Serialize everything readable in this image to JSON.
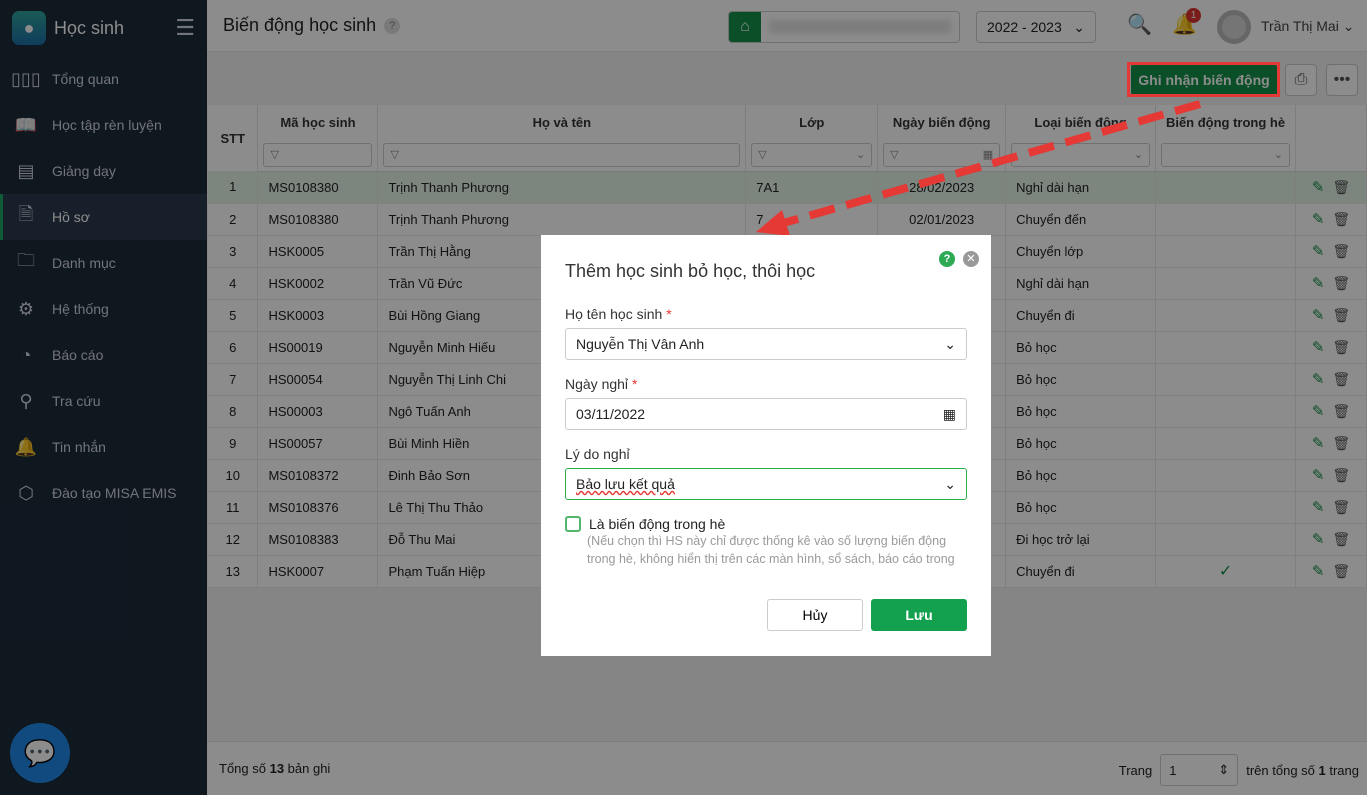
{
  "app": {
    "name": "Học sinh"
  },
  "sidebar": {
    "items": [
      {
        "label": "Tổng quan",
        "icon": "chart-bars-icon"
      },
      {
        "label": "Học tập rèn luyện",
        "icon": "book-icon"
      },
      {
        "label": "Giảng dạy",
        "icon": "board-icon"
      },
      {
        "label": "Hồ sơ",
        "icon": "document-icon",
        "active": true
      },
      {
        "label": "Danh mục",
        "icon": "folder-icon"
      },
      {
        "label": "Hệ thống",
        "icon": "gear-icon"
      },
      {
        "label": "Báo cáo",
        "icon": "pie-chart-icon"
      },
      {
        "label": "Tra cứu",
        "icon": "search-icon"
      },
      {
        "label": "Tin nhắn",
        "icon": "bell-icon"
      },
      {
        "label": "Đào tạo MISA EMIS",
        "icon": "box-icon"
      }
    ]
  },
  "header": {
    "title": "Biến động học sinh",
    "help": "?",
    "school_year": "2022 - 2023",
    "notification_count": "1",
    "user_name": "Trần Thị Mai"
  },
  "toolbar": {
    "record_button": "Ghi nhận biến động"
  },
  "table": {
    "columns": [
      "STT",
      "Mã học sinh",
      "Họ và tên",
      "Lớp",
      "Ngày biến động",
      "Loại biến động",
      "Biến động trong hè"
    ],
    "rows": [
      {
        "stt": "1",
        "code": "MS0108380",
        "name": "Trịnh Thanh Phương",
        "class": "7A1",
        "date": "28/02/2023",
        "type": "Nghỉ dài hạn",
        "summer": ""
      },
      {
        "stt": "2",
        "code": "MS0108380",
        "name": "Trịnh Thanh Phương",
        "class": "7",
        "date": "02/01/2023",
        "type": "Chuyển đến",
        "summer": ""
      },
      {
        "stt": "3",
        "code": "HSK0005",
        "name": "Trần Thị Hằng",
        "class": "",
        "date": "",
        "type": "Chuyển lớp",
        "summer": ""
      },
      {
        "stt": "4",
        "code": "HSK0002",
        "name": "Trần Vũ Đức",
        "class": "",
        "date": "",
        "type": "Nghỉ dài hạn",
        "summer": ""
      },
      {
        "stt": "5",
        "code": "HSK0003",
        "name": "Bùi Hồng Giang",
        "class": "",
        "date": "",
        "type": "Chuyển đi",
        "summer": ""
      },
      {
        "stt": "6",
        "code": "HS00019",
        "name": "Nguyễn Minh Hiếu",
        "class": "",
        "date": "",
        "type": "Bỏ học",
        "summer": ""
      },
      {
        "stt": "7",
        "code": "HS00054",
        "name": "Nguyễn Thị Linh Chi",
        "class": "",
        "date": "",
        "type": "Bỏ học",
        "summer": ""
      },
      {
        "stt": "8",
        "code": "HS00003",
        "name": "Ngô Tuấn Anh",
        "class": "",
        "date": "",
        "type": "Bỏ học",
        "summer": ""
      },
      {
        "stt": "9",
        "code": "HS00057",
        "name": "Bùi Minh Hiền",
        "class": "",
        "date": "",
        "type": "Bỏ học",
        "summer": ""
      },
      {
        "stt": "10",
        "code": "MS0108372",
        "name": "Đinh Bảo Sơn",
        "class": "",
        "date": "",
        "type": "Bỏ học",
        "summer": ""
      },
      {
        "stt": "11",
        "code": "MS0108376",
        "name": "Lê Thị Thu Thảo",
        "class": "",
        "date": "",
        "type": "Bỏ học",
        "summer": ""
      },
      {
        "stt": "12",
        "code": "MS0108383",
        "name": "Đỗ Thu Mai",
        "class": "",
        "date": "",
        "type": "Đi học trở lại",
        "summer": ""
      },
      {
        "stt": "13",
        "code": "HSK0007",
        "name": "Phạm Tuấn Hiệp",
        "class": "",
        "date": "",
        "type": "Chuyển đi",
        "summer": "✓"
      }
    ]
  },
  "footer": {
    "total_prefix": "Tổng số ",
    "total": "13",
    "total_suffix": " bản ghi",
    "page_label": "Trang",
    "page": "1",
    "pages_prefix": "trên tổng số ",
    "pages": "1",
    "pages_suffix": " trang"
  },
  "modal": {
    "title": "Thêm học sinh bỏ học, thôi học",
    "student_label": "Họ tên học sinh",
    "student_value": "Nguyễn Thị Vân Anh",
    "date_label": "Ngày nghỉ",
    "date_value": "03/11/2022",
    "reason_label": "Lý do nghỉ",
    "reason_value": "Bảo lưu kết quả",
    "summer_label": "Là biến động trong hè",
    "summer_note": "(Nếu chọn thì HS này chỉ được thống kê vào số lượng biến động trong hè, không hiển thị trên các màn hình, sổ sách, báo cáo trong năm học)",
    "cancel": "Hủy",
    "save": "Lưu",
    "required": "*"
  },
  "colors": {
    "primary": "#13914a",
    "annotation": "#e53935",
    "sidebar": "#1d2a3a"
  }
}
